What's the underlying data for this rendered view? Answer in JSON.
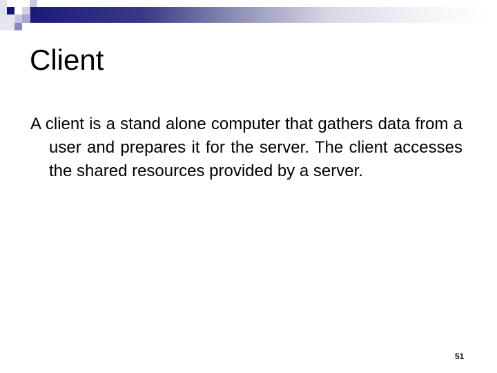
{
  "slide": {
    "title": "Client",
    "body": "A client is a stand alone computer that gathers data from a user and prepares it for the server. The client accesses the shared resources provided by a server.",
    "page_number": "51"
  },
  "theme": {
    "accent_dark": "#1a1a7a",
    "accent_light": "#c8c8e0"
  }
}
